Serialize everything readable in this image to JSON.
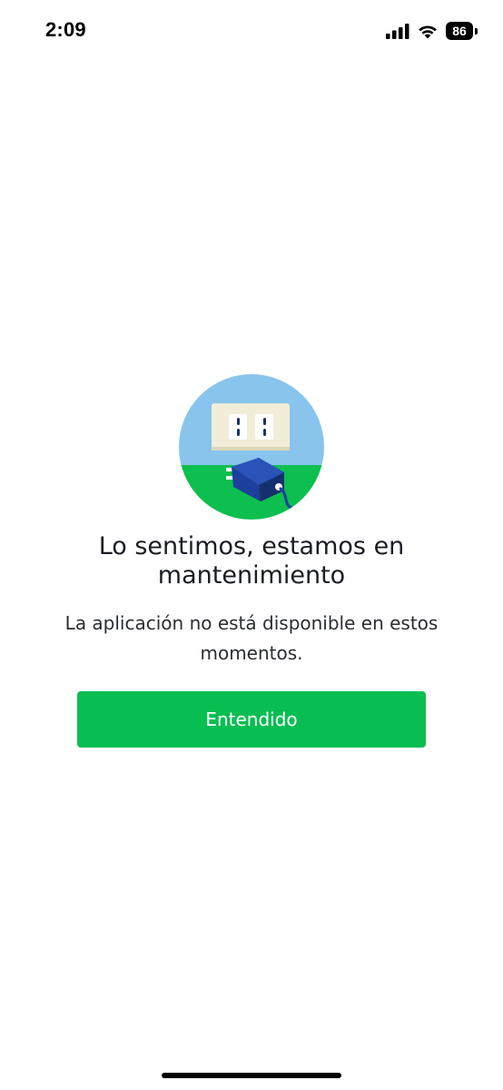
{
  "status_bar": {
    "time": "2:09",
    "battery_level": "86",
    "icons": [
      "signal-icon",
      "wifi-icon",
      "battery-icon"
    ]
  },
  "illustration": {
    "icon": "unplugged-outlet-illustration",
    "colors": {
      "sky": "#88c4ec",
      "ground": "#0cbf4f",
      "outlet_plate": "#f2edd8",
      "charger": "#1d3f9e"
    }
  },
  "message": {
    "title": "Lo sentimos, estamos en mantenimiento",
    "subtitle": "La aplicación no está disponible en estos momentos."
  },
  "actions": {
    "confirm_label": "Entendido"
  },
  "colors": {
    "accent": "#08be52",
    "background": "#ffffff"
  }
}
